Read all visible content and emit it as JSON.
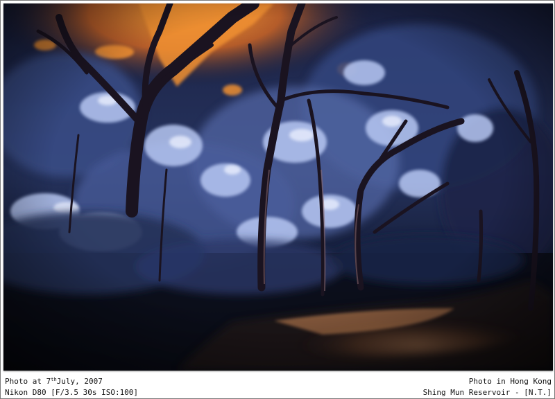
{
  "photo": {
    "subject": "infrared-forest-path",
    "colors": {
      "sky_orange": "#e8892a",
      "foliage_blue": "#9fb3e6",
      "foliage_bright": "#dfe8ff",
      "shadow": "#0b1020",
      "path_light": "#c97a4a"
    }
  },
  "caption": {
    "date_prefix": "Photo at 7",
    "date_suffix": "th",
    "date_rest": "July, 2007",
    "camera": "Nikon D80 [F/3.5 30s ISO:100]",
    "location_top": "Photo in Hong Kong",
    "location_bottom": "Shing Mun Reservoir - [N.T.]"
  }
}
